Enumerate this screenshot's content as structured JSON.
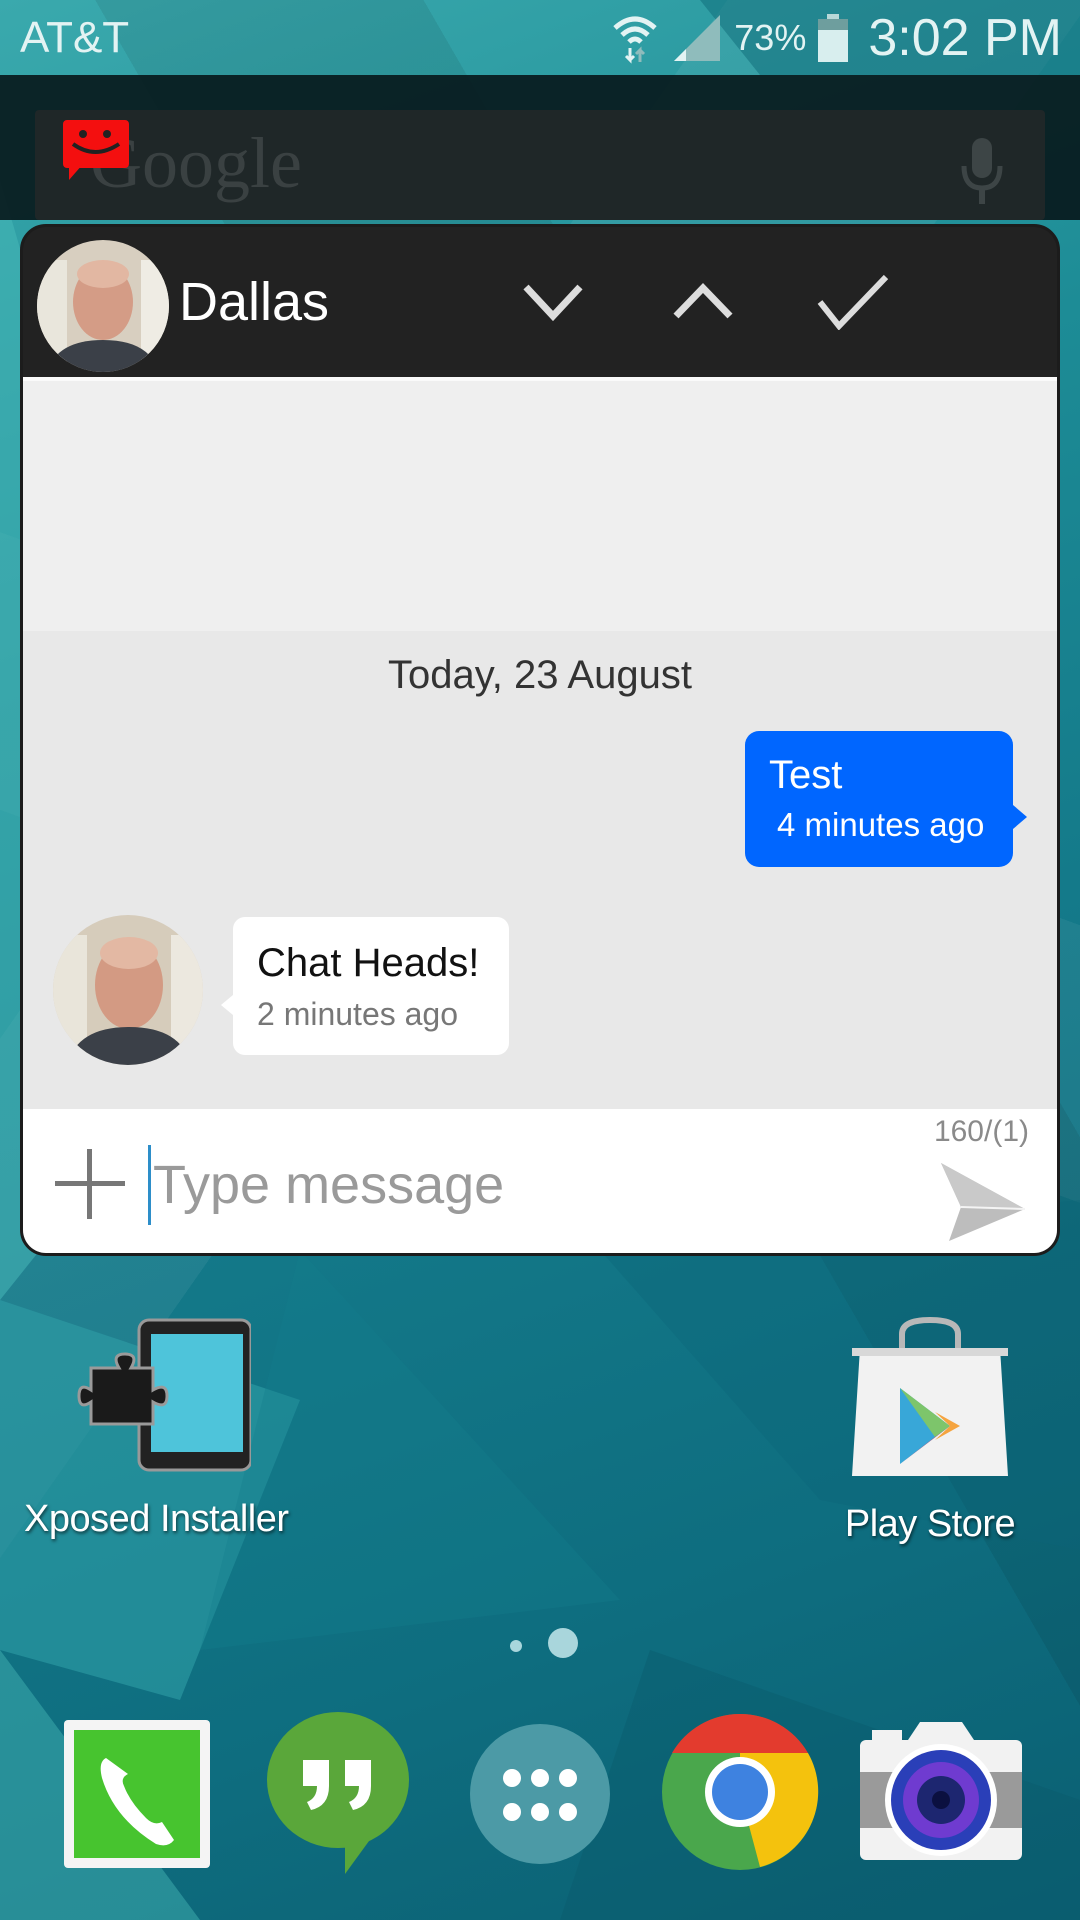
{
  "status_bar": {
    "carrier": "AT&T",
    "battery_percent": "73%",
    "battery_level": 0.73,
    "time": "3:02 PM",
    "icons": [
      "wifi-data-icon",
      "signal-icon",
      "battery-icon"
    ]
  },
  "search_widget": {
    "logo_text": "Google",
    "icons": [
      "mic-icon",
      "chathead-badge-icon"
    ]
  },
  "chat": {
    "contact_name": "Dallas",
    "header_buttons": [
      {
        "name": "minimize",
        "icon": "chevron-down-icon"
      },
      {
        "name": "expand",
        "icon": "chevron-up-icon"
      },
      {
        "name": "mark-read",
        "icon": "check-icon"
      }
    ],
    "date_separator": "Today, 23 August",
    "messages": [
      {
        "direction": "outgoing",
        "text": "Test",
        "time": "4 minutes ago"
      },
      {
        "direction": "incoming",
        "text": "Chat Heads!",
        "time": "2 minutes ago"
      }
    ],
    "composer": {
      "char_counter": "160/(1)",
      "placeholder": "Type message",
      "value": ""
    },
    "colors": {
      "outgoing_bubble": "#0066ff",
      "incoming_bubble": "#ffffff",
      "header": "#222222"
    }
  },
  "home_screen": {
    "apps": [
      {
        "label": "Xposed Installer",
        "icon": "xposed-installer-icon"
      },
      {
        "label": "Play Store",
        "icon": "play-store-icon"
      }
    ],
    "page_indicator": {
      "pages": 2,
      "current": 2
    },
    "dock": [
      {
        "name": "Phone",
        "icon": "phone-icon"
      },
      {
        "name": "Hangouts",
        "icon": "hangouts-icon"
      },
      {
        "name": "Apps",
        "icon": "app-drawer-icon"
      },
      {
        "name": "Chrome",
        "icon": "chrome-icon"
      },
      {
        "name": "Camera",
        "icon": "camera-icon"
      }
    ]
  }
}
